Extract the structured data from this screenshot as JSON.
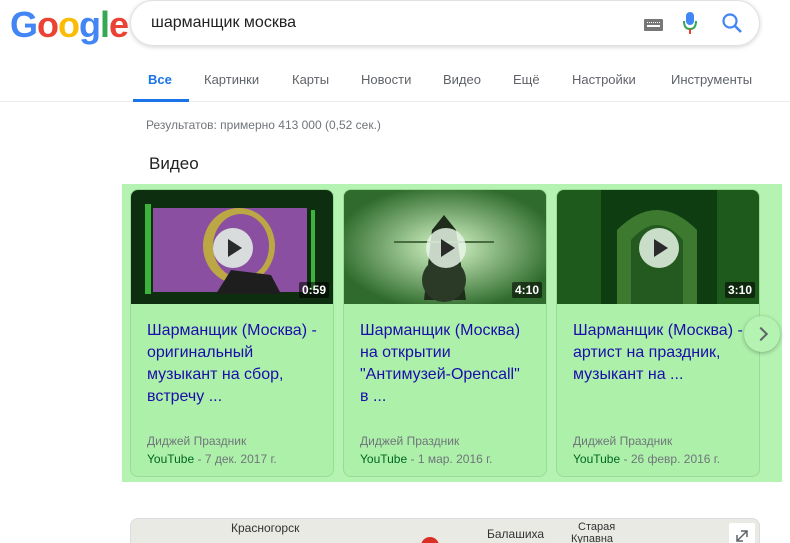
{
  "logo": {
    "text": "Google",
    "colors": [
      "#4285f4",
      "#ea4335",
      "#fbbc05",
      "#4285f4",
      "#34a853",
      "#ea4335"
    ]
  },
  "search": {
    "query": "шарманщик москва"
  },
  "tabs": [
    {
      "label": "Все",
      "active": true
    },
    {
      "label": "Картинки"
    },
    {
      "label": "Карты"
    },
    {
      "label": "Новости"
    },
    {
      "label": "Видео"
    },
    {
      "label": "Ещё"
    },
    {
      "label": "Настройки"
    },
    {
      "label": "Инструменты"
    }
  ],
  "stats": "Результатов: примерно 413 000 (0,52 сек.)",
  "videos": {
    "title": "Видео",
    "items": [
      {
        "title": "Шарманщик (Москва) -\nоригинальный\nмузыкант на сбор,\nвстречу ...",
        "duration": "0:59",
        "channel": "Диджей Праздник",
        "source": "YouTube",
        "date": " - 7 дек. 2017 г."
      },
      {
        "title": "Шарманщик (Москва)\nна открытии\n\"Антимузей-Opencall\"\nв ...",
        "duration": "4:10",
        "channel": "Диджей Праздник",
        "source": "YouTube",
        "date": " - 1 мар. 2016 г."
      },
      {
        "title": "Шарманщик (Москва) -\nартист на праздник,\nмузыкант на ...",
        "duration": "3:10",
        "channel": "Диджей Праздник",
        "source": "YouTube",
        "date": " - 26 февр. 2016 г."
      }
    ]
  },
  "map": {
    "labels": [
      "Красногорск",
      "Балашиха",
      "Старая",
      "Купавна"
    ]
  },
  "colors": {
    "accent": "#1a73e8",
    "link": "#1a0dab",
    "source": "#006621",
    "highlight": "#b4f3b1"
  }
}
